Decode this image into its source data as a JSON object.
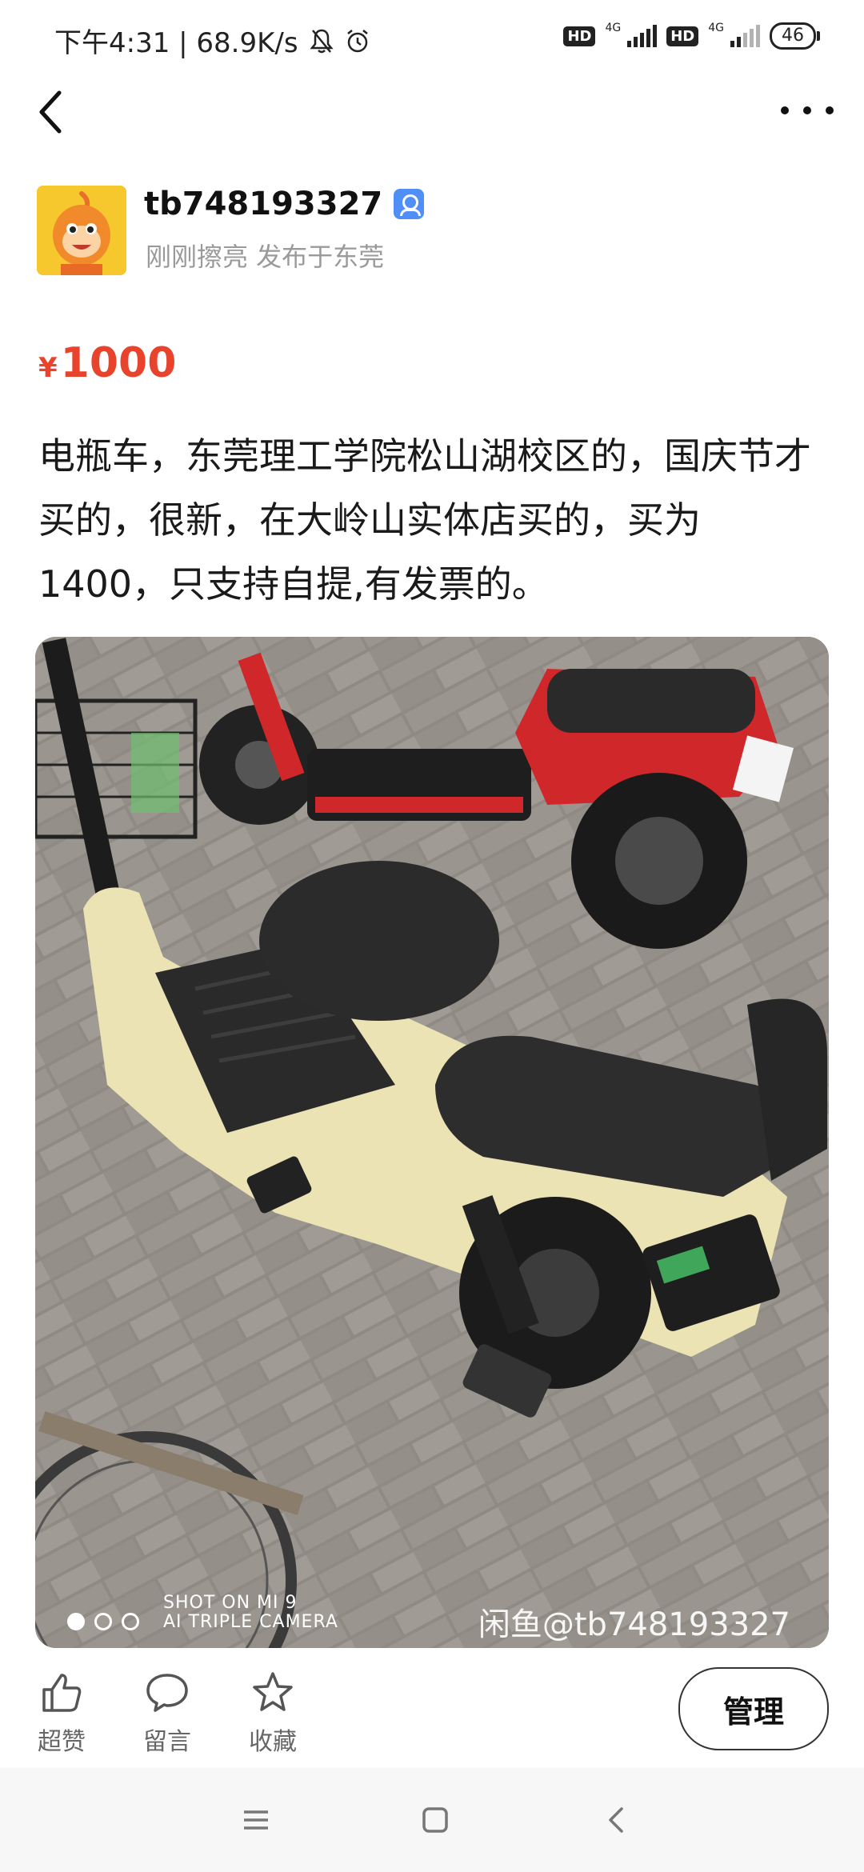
{
  "status_bar": {
    "time_speed": "下午4:31 | 68.9K/s",
    "hd1": "HD",
    "net1": "4G",
    "hd2": "HD",
    "net2": "4G",
    "battery": "46"
  },
  "user": {
    "name": "tb748193327",
    "meta": "刚刚擦亮 发布于东莞"
  },
  "listing": {
    "currency": "¥",
    "price": "1000",
    "description": "电瓶车，东莞理工学院松山湖校区的，国庆节才买的，很新，在大岭山实体店买的，买为1400，只支持自提,有发票的。"
  },
  "photo": {
    "camera_tag_line1": "SHOT ON MI 9",
    "camera_tag_line2": "AI TRIPLE CAMERA",
    "watermark": "闲鱼@tb748193327"
  },
  "actions": {
    "like": "超赞",
    "comment": "留言",
    "favorite": "收藏",
    "manage": "管理"
  },
  "colors": {
    "price": "#e8442d",
    "verify_badge": "#4f8ff7",
    "avatar_bg": "#f7c72e"
  }
}
